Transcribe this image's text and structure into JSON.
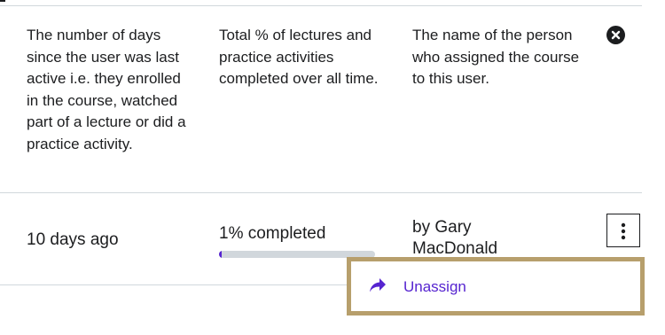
{
  "columns": {
    "last_active_description": "The number of days since the user was last active i.e. they enrolled in the course, watched part of a lecture or did a practice activity.",
    "progress_description": "Total % of lectures and practice activities completed over all time.",
    "assigned_by_description": "The name of the person who assigned the course to this user."
  },
  "row": {
    "last_active": "10 days ago",
    "progress_label": "1% completed",
    "progress_fraction": 0.01,
    "assigned_by": "by Gary MacDonald"
  },
  "menu": {
    "unassign_label": "Unassign"
  },
  "icons": {
    "close": "close-circle-icon",
    "more": "more-vertical-icon",
    "unassign": "share-arrow-icon"
  },
  "colors": {
    "accent": "#5624d0",
    "text": "#1c1d1f",
    "divider": "#d1d7dc",
    "highlight_border": "#b79f6c"
  }
}
